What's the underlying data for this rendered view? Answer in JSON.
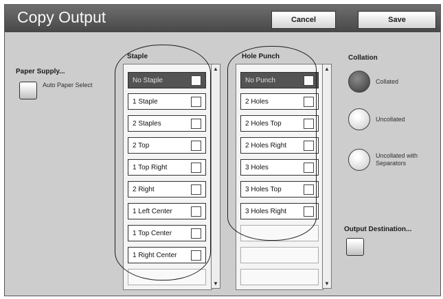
{
  "header": {
    "title": "Copy Output",
    "cancel_label": "Cancel",
    "save_label": "Save"
  },
  "paper_supply": {
    "label": "Paper Supply...",
    "value": "Auto Paper Select"
  },
  "staple": {
    "heading": "Staple",
    "items": [
      {
        "label": "No Staple",
        "selected": true
      },
      {
        "label": "1 Staple"
      },
      {
        "label": "2 Staples"
      },
      {
        "label": "2 Top"
      },
      {
        "label": "1 Top Right"
      },
      {
        "label": "2 Right"
      },
      {
        "label": "1 Left Center"
      },
      {
        "label": "1 Top Center"
      },
      {
        "label": "1 Right Center"
      }
    ]
  },
  "hole_punch": {
    "heading": "Hole Punch",
    "items": [
      {
        "label": "No Punch",
        "selected": true
      },
      {
        "label": "2 Holes"
      },
      {
        "label": "2 Holes Top"
      },
      {
        "label": "2 Holes Right"
      },
      {
        "label": "3 Holes"
      },
      {
        "label": "3 Holes Top"
      },
      {
        "label": "3 Holes Right"
      }
    ]
  },
  "collation": {
    "heading": "Collation",
    "options": [
      {
        "label": "Collated",
        "selected": true
      },
      {
        "label": "Uncollated"
      },
      {
        "label": "Uncollated with Separators"
      }
    ]
  },
  "output_destination": {
    "label": "Output Destination..."
  }
}
